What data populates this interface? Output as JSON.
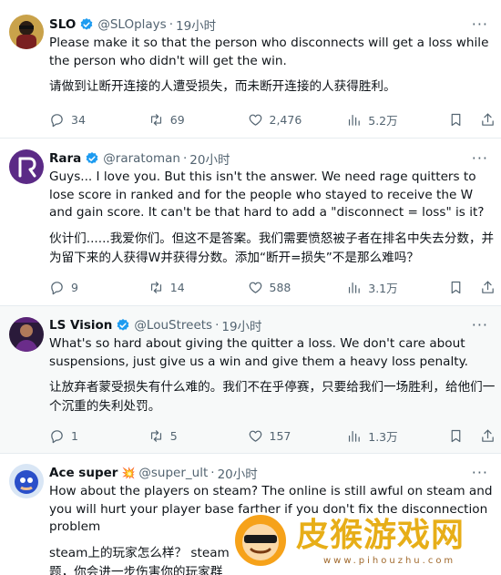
{
  "tweets": [
    {
      "name": "SLO",
      "handle": "@SLOplays",
      "time": "19小时",
      "text": "Please make it so that the person who disconnects will get a loss while the person who didn't will get the win.",
      "translation": "请做到让断开连接的人遭受损失，而未断开连接的人获得胜利。",
      "replies": "34",
      "reposts": "69",
      "likes": "2,476",
      "views": "5.2万"
    },
    {
      "name": "Rara",
      "handle": "@raratoman",
      "time": "20小时",
      "text": "Guys... I love you. But this isn't the answer. We need rage quitters to lose score in ranked and for the people who stayed to receive the W and gain score. It can't be that hard to add a \"disconnect = loss\" is it?",
      "translation": "伙计们......我爱你们。但这不是答案。我们需要愤怒被子者在排名中失去分数，并为留下来的人获得W并获得分数。添加“断开=损失”不是那么难吗？",
      "replies": "9",
      "reposts": "14",
      "likes": "588",
      "views": "3.1万"
    },
    {
      "name": "LS Vision",
      "handle": "@LouStreets",
      "time": "19小时",
      "text": "What's so hard about giving the quitter a loss. We don't care about suspensions, just give us a win and give them a heavy loss penalty.",
      "translation": "让放弃者蒙受损失有什么难的。我们不在乎停赛，只要给我们一场胜利，给他们一个沉重的失利处罚。",
      "replies": "1",
      "reposts": "5",
      "likes": "157",
      "views": "1.3万"
    },
    {
      "name": "Ace super",
      "handle": "@super_ult",
      "time": "20小时",
      "text": "How about the players on steam? The online is still awful on steam and you will hurt your player base farther if you don't fix the disconnection problem",
      "translation_line1": "steam上的玩家怎么样？ steam",
      "translation_line2": "题，你会进一步伤害你的玩家群"
    }
  ],
  "watermark": {
    "title": "皮猴游戏网",
    "url": "www.pihouzhu.com"
  },
  "colors": {
    "verified": "#1d9bf0",
    "muted": "#536471",
    "text": "#0f1419",
    "highlight_bg": "#f7f9f9"
  },
  "icons": [
    "reply-icon",
    "repost-icon",
    "like-icon",
    "views-icon",
    "bookmark-icon",
    "share-icon",
    "more-icon",
    "verified-badge-icon"
  ]
}
